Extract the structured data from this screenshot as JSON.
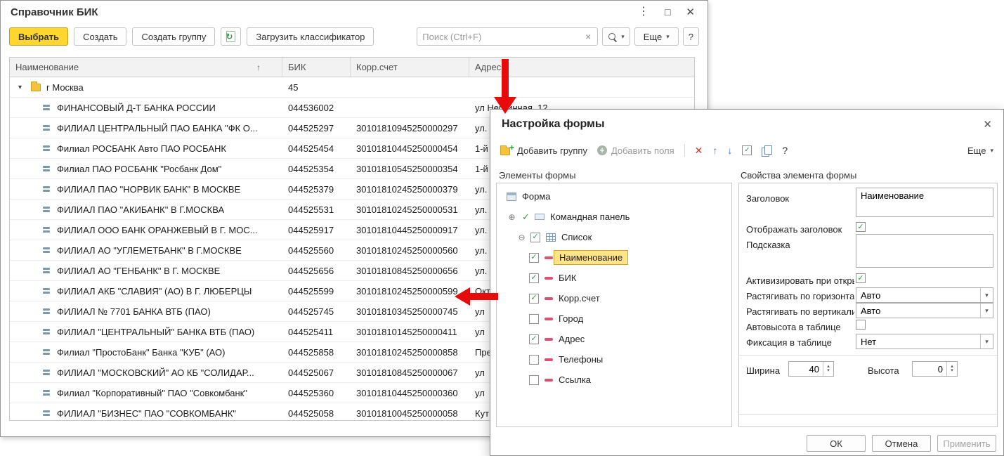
{
  "icons": {
    "kebab": "⋮",
    "maximize": "□",
    "close": "✕",
    "sort_asc": "↑",
    "dropdown": "▾",
    "clear": "×",
    "refresh": "↻",
    "expander_open": "▾",
    "tree_expand": "⊕",
    "tree_collapse": "⊖",
    "check": "✓",
    "delete_x": "✕",
    "move_up": "↑",
    "move_down": "↓",
    "help": "?",
    "spin_up": "▴",
    "spin_down": "▾"
  },
  "colors": {
    "accent_yellow": "#ffd62e",
    "highlight_yellow": "#ffe48a",
    "arrow_red": "#e80b0b",
    "check_green": "#2f9e44"
  },
  "main_window": {
    "title": "Справочник БИК",
    "toolbar": {
      "select": "Выбрать",
      "create": "Создать",
      "create_group": "Создать группу",
      "load_classifier": "Загрузить классификатор",
      "search_placeholder": "Поиск (Ctrl+F)",
      "more": "Еще",
      "help": "?"
    },
    "table": {
      "columns": {
        "name": "Наименование",
        "bik": "БИК",
        "corr": "Корр.счет",
        "addr": "Адрес"
      },
      "group": {
        "name": "г Москва",
        "bik": "45"
      },
      "rows": [
        {
          "name": "ФИНАНСОВЫЙ Д-Т БАНКА РОССИИ",
          "bik": "044536002",
          "corr": "",
          "addr": "ул Неглинная, 12"
        },
        {
          "name": "ФИЛИАЛ ЦЕНТРАЛЬНЫЙ ПАО БАНКА \"ФК О...",
          "bik": "044525297",
          "corr": "30101810945250000297",
          "addr": "ул."
        },
        {
          "name": "Филиал РОСБАНК Авто ПАО РОСБАНК",
          "bik": "044525454",
          "corr": "30101810445250000454",
          "addr": "1-й"
        },
        {
          "name": "Филиал ПАО РОСБАНК \"Росбанк Дом\"",
          "bik": "044525354",
          "corr": "30101810545250000354",
          "addr": "1-й"
        },
        {
          "name": "ФИЛИАЛ ПАО \"НОРВИК БАНК\" В МОСКВЕ",
          "bik": "044525379",
          "corr": "30101810245250000379",
          "addr": "ул."
        },
        {
          "name": "ФИЛИАЛ ПАО \"АКИБАНК\" В Г.МОСКВА",
          "bik": "044525531",
          "corr": "30101810245250000531",
          "addr": "ул."
        },
        {
          "name": "ФИЛИАЛ ООО БАНК ОРАНЖЕВЫЙ В Г. МОС...",
          "bik": "044525917",
          "corr": "30101810445250000917",
          "addr": "ул."
        },
        {
          "name": "ФИЛИАЛ АО \"УГЛЕМЕТБАНК\" В Г.МОСКВЕ",
          "bik": "044525560",
          "corr": "30101810245250000560",
          "addr": "ул."
        },
        {
          "name": "ФИЛИАЛ АО \"ГЕНБАНК\" В Г. МОСКВЕ",
          "bik": "044525656",
          "corr": "30101810845250000656",
          "addr": "ул."
        },
        {
          "name": "ФИЛИАЛ АКБ \"СЛАВИЯ\" (АО) В Г. ЛЮБЕРЦЫ",
          "bik": "044525599",
          "corr": "30101810245250000599",
          "addr": "Окт"
        },
        {
          "name": "ФИЛИАЛ № 7701 БАНКА ВТБ (ПАО)",
          "bik": "044525745",
          "corr": "30101810345250000745",
          "addr": "ул"
        },
        {
          "name": "ФИЛИАЛ \"ЦЕНТРАЛЬНЫЙ\" БАНКА ВТБ (ПАО)",
          "bik": "044525411",
          "corr": "30101810145250000411",
          "addr": "ул"
        },
        {
          "name": "Филиал \"ПростоБанк\" Банка \"КУБ\" (АО)",
          "bik": "044525858",
          "corr": "30101810245250000858",
          "addr": "Пре"
        },
        {
          "name": "ФИЛИАЛ \"МОСКОВСКИЙ\" АО КБ \"СОЛИДАР...",
          "bik": "044525067",
          "corr": "30101810845250000067",
          "addr": "ул"
        },
        {
          "name": "Филиал \"Корпоративный\" ПАО \"Совкомбанк\"",
          "bik": "044525360",
          "corr": "30101810445250000360",
          "addr": "ул"
        },
        {
          "name": "ФИЛИАЛ \"БИЗНЕС\" ПАО \"СОВКОМБАНК\"",
          "bik": "044525058",
          "corr": "30101810045250000058",
          "addr": "Кут"
        }
      ]
    }
  },
  "dialog": {
    "title": "Настройка формы",
    "toolbar": {
      "add_group": "Добавить группу",
      "add_fields": "Добавить поля",
      "more": "Еще"
    },
    "left_label": "Элементы формы",
    "right_label": "Свойства элемента формы",
    "tree": {
      "root": "Форма",
      "command_bar": "Командная панель",
      "command_bar_check": "✓",
      "list": "Список",
      "list_check": "✓",
      "fields": [
        {
          "label": "Наименование",
          "check": "✓"
        },
        {
          "label": "БИК",
          "check": "✓"
        },
        {
          "label": "Корр.счет",
          "check": "✓"
        },
        {
          "label": "Город",
          "check": ""
        },
        {
          "label": "Адрес",
          "check": "✓"
        },
        {
          "label": "Телефоны",
          "check": ""
        },
        {
          "label": "Ссылка",
          "check": ""
        }
      ]
    },
    "props": {
      "title_label": "Заголовок",
      "title_value": "Наименование",
      "show_title": "Отображать заголовок",
      "show_title_check": "✓",
      "tooltip": "Подсказка",
      "tooltip_value": "",
      "activate": "Активизировать при откры",
      "activate_check": "✓",
      "stretch_h": "Растягивать по горизонта",
      "stretch_h_value": "Авто",
      "stretch_v": "Растягивать по вертикали",
      "stretch_v_value": "Авто",
      "autoheight": "Автовысота в таблице",
      "autoheight_check": "",
      "fixation": "Фиксация в таблице",
      "fixation_value": "Нет",
      "width": "Ширина",
      "width_value": "40",
      "height": "Высота",
      "height_value": "0"
    },
    "buttons": {
      "ok": "ОК",
      "cancel": "Отмена",
      "apply": "Применить"
    }
  }
}
